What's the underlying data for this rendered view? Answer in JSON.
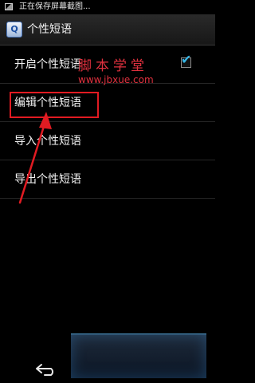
{
  "status_bar": {
    "notification_text": "正在保存屏幕截图..."
  },
  "action_bar": {
    "app_icon_glyph": "Q",
    "title": "个性短语"
  },
  "list": {
    "items": [
      {
        "label": "开启个性短语",
        "checked": true
      },
      {
        "label": "编辑个性短语"
      },
      {
        "label": "导入个性短语"
      },
      {
        "label": "导出个性短语"
      }
    ]
  },
  "watermark": {
    "title": "脚本学堂",
    "url": "www.jbxue.com"
  },
  "colors": {
    "annotation_red": "#e11b22",
    "check_blue": "#35b5e5"
  },
  "nav": {
    "back_icon": "back-arrow-icon"
  }
}
